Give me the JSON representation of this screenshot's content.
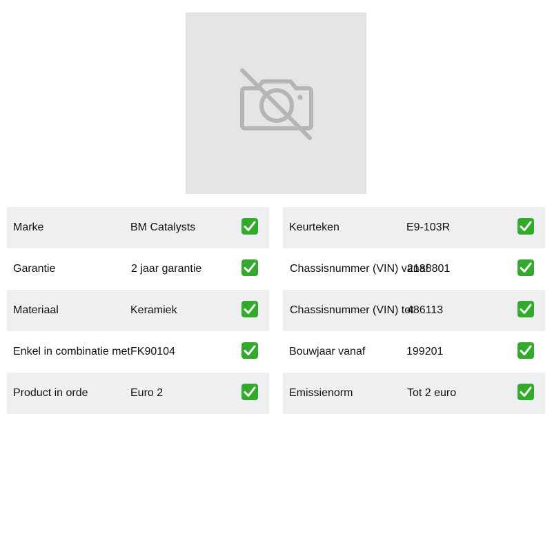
{
  "product_image": {
    "icon": "camera-off-icon"
  },
  "specs_left": [
    {
      "label": "Marke",
      "value": "BM Catalysts",
      "icon": "check-icon"
    },
    {
      "label": "Garantie",
      "value": "2 jaar garantie",
      "icon": "check-icon"
    },
    {
      "label": "Materiaal",
      "value": "Keramiek",
      "icon": "check-icon"
    },
    {
      "label": "Enkel in combinatie met",
      "value": "FK90104",
      "icon": "check-icon"
    },
    {
      "label": "Product in orde",
      "value": "Euro 2",
      "icon": "check-icon"
    }
  ],
  "specs_right": [
    {
      "label": "Keurteken",
      "value": "E9-103R",
      "icon": "check-icon"
    },
    {
      "label": "Chassisnummer (VIN) vanaf",
      "value": "2188801",
      "icon": "check-icon"
    },
    {
      "label": "Chassisnummer (VIN) tot",
      "value": "486113",
      "icon": "check-icon"
    },
    {
      "label": "Bouwjaar vanaf",
      "value": "199201",
      "icon": "check-icon"
    },
    {
      "label": "Emissienorm",
      "value": "Tot 2 euro",
      "icon": "check-icon"
    }
  ],
  "colors": {
    "row_shade": "#efefef",
    "check_green": "#33aa2e",
    "placeholder_bg": "#e5e5e5",
    "placeholder_icon": "#b5b5b5"
  }
}
